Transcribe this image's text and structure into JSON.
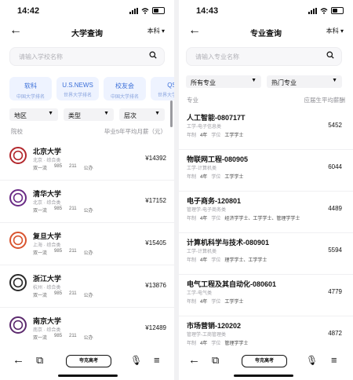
{
  "left": {
    "time": "14:42",
    "title": "大学查询",
    "level": "本科",
    "search_placeholder": "请输入学校名称",
    "rankings": [
      {
        "title": "软科",
        "subtitle": "中国大学排名"
      },
      {
        "title": "U.S.NEWS",
        "subtitle": "世界大学排名"
      },
      {
        "title": "校友会",
        "subtitle": "中国大学排名"
      },
      {
        "title": "QS",
        "subtitle": "世界大学排名"
      }
    ],
    "filters": [
      "地区",
      "类型",
      "层次"
    ],
    "col_school": "院校",
    "col_salary": "毕业5年平均月薪（元）",
    "universities": [
      {
        "name": "北京大学",
        "location": "北京 · 综合类",
        "tags": [
          "双一流",
          "985",
          "211",
          "公办"
        ],
        "salary": "¥14392",
        "logo_color": "#b3282d"
      },
      {
        "name": "清华大学",
        "location": "北京 · 综合类",
        "tags": [
          "双一流",
          "985",
          "211",
          "公办"
        ],
        "salary": "¥17152",
        "logo_color": "#6a2c86"
      },
      {
        "name": "复旦大学",
        "location": "上海 · 综合类",
        "tags": [
          "双一流",
          "985",
          "211",
          "公办"
        ],
        "salary": "¥15405",
        "logo_color": "#d9542f"
      },
      {
        "name": "浙江大学",
        "location": "杭州 · 综合类",
        "tags": [
          "双一流",
          "985",
          "211",
          "公办"
        ],
        "salary": "¥13876",
        "logo_color": "#2a2a2a"
      },
      {
        "name": "南京大学",
        "location": "南京 · 综合类",
        "tags": [
          "双一流",
          "985",
          "211",
          "公办"
        ],
        "salary": "¥12489",
        "logo_color": "#5c2a6e"
      }
    ],
    "bottom_pill": "夸克高考"
  },
  "right": {
    "time": "14:43",
    "title": "专业查询",
    "level": "本科",
    "search_placeholder": "请输入专业名称",
    "filters": [
      "所有专业",
      "热门专业"
    ],
    "col_major": "专业",
    "col_salary": "应届生平均薪酬",
    "majors": [
      {
        "name": "人工智能-080717T",
        "category": "工学-电子信息类",
        "years_label": "年制",
        "years": "4年",
        "degree_label": "学位",
        "degree": "工学学士",
        "salary": "5452"
      },
      {
        "name": "物联网工程-080905",
        "category": "工学-计算机类",
        "years_label": "年制",
        "years": "4年",
        "degree_label": "学位",
        "degree": "工学学士",
        "salary": "6044"
      },
      {
        "name": "电子商务-120801",
        "category": "管理学-电子商务类",
        "years_label": "年制",
        "years": "4年",
        "degree_label": "学位",
        "degree": "经济学学士、工学学士、管理学学士",
        "salary": "4489"
      },
      {
        "name": "计算机科学与技术-080901",
        "category": "工学-计算机类",
        "years_label": "年制",
        "years": "4年",
        "degree_label": "学位",
        "degree": "理学学士、工学学士",
        "salary": "5594"
      },
      {
        "name": "电气工程及其自动化-080601",
        "category": "工学-电气类",
        "years_label": "年制",
        "years": "4年",
        "degree_label": "学位",
        "degree": "工学学士",
        "salary": "4779"
      },
      {
        "name": "市场营销-120202",
        "category": "管理学-工商管理类",
        "years_label": "年制",
        "years": "4年",
        "degree_label": "学位",
        "degree": "管理学学士",
        "salary": "4872"
      }
    ],
    "bottom_pill": "夸克高考"
  }
}
